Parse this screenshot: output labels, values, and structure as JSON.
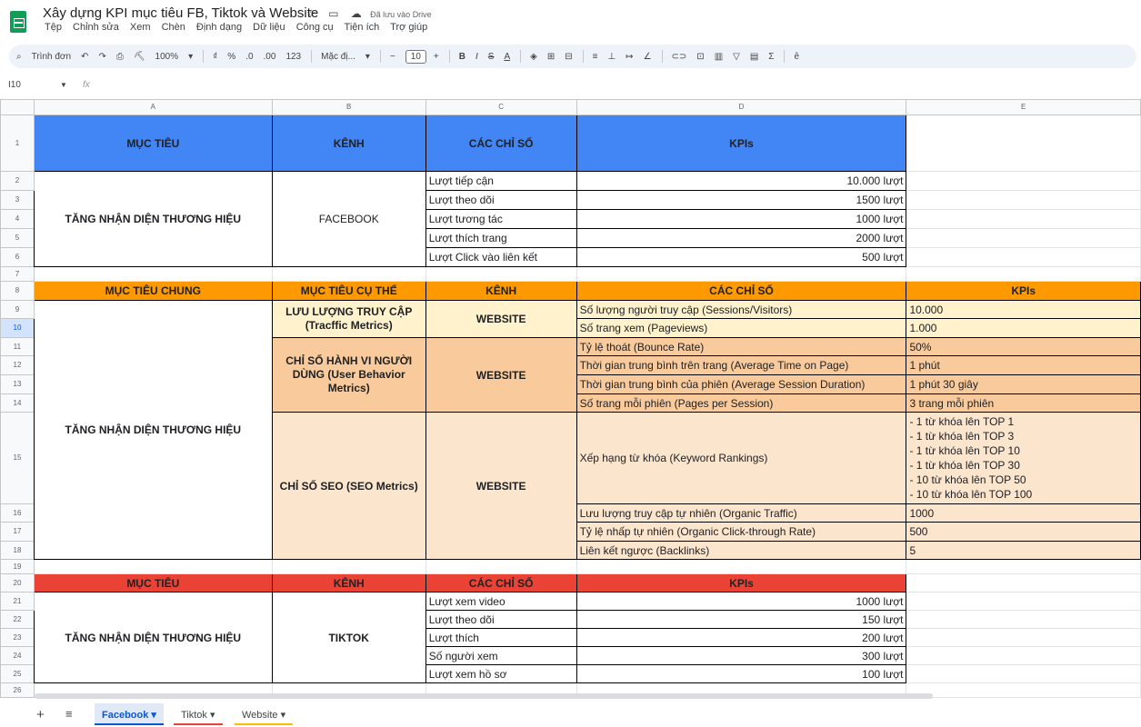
{
  "app": {
    "title": "Xây dựng KPI mục tiêu FB, Tiktok và Website",
    "save_status": "Đã lưu vào Drive",
    "icons": [
      "star-icon",
      "folder-move-icon",
      "cloud-saved-icon"
    ]
  },
  "menu": [
    "Tệp",
    "Chỉnh sửa",
    "Xem",
    "Chèn",
    "Định dạng",
    "Dữ liệu",
    "Công cụ",
    "Tiện ích",
    "Trợ giúp"
  ],
  "toolbar": {
    "search": "Trình đơn",
    "undo": "↶",
    "redo": "↷",
    "print": "⎙",
    "paint_format": "⛏",
    "zoom": "100%",
    "currency": "₫",
    "percent": "%",
    "dec_decrease": ".0",
    "dec_increase": ".00",
    "format_123": "123",
    "font": "Mặc đị...",
    "minus": "−",
    "font_size": "10",
    "plus": "+",
    "bold": "B",
    "italic": "I",
    "strike": "S",
    "text_color": "A"
  },
  "formula_bar": {
    "cell_ref": "I10",
    "fx": "fx",
    "value": ""
  },
  "columns": [
    "A",
    "B",
    "C",
    "D",
    "E"
  ],
  "rows": [
    "1",
    "2",
    "3",
    "4",
    "5",
    "6",
    "7",
    "8",
    "9",
    "10",
    "11",
    "12",
    "13",
    "14",
    "15",
    "16",
    "17",
    "18",
    "19",
    "20",
    "21",
    "22",
    "23",
    "24",
    "25",
    "26"
  ],
  "sheet": {
    "fb": {
      "headers": [
        "MỤC TIÊU",
        "KÊNH",
        "CÁC CHỈ SỐ",
        "KPIs"
      ],
      "goal": "TĂNG NHẬN DIỆN THƯƠNG HIỆU",
      "channel": "FACEBOOK",
      "metrics": [
        {
          "name": "Lượt tiếp cận",
          "kpi": "10.000 lượt"
        },
        {
          "name": "Lượt theo dõi",
          "kpi": "1500 lượt"
        },
        {
          "name": "Lượt tương tác",
          "kpi": "1000 lượt"
        },
        {
          "name": "Lượt thích trang",
          "kpi": "2000 lượt"
        },
        {
          "name": "Lượt Click vào liên kết",
          "kpi": "500 lượt"
        }
      ]
    },
    "web": {
      "headers": [
        "MỤC TIÊU CHUNG",
        "MỤC TIÊU CỤ THỂ",
        "KÊNH",
        "CÁC CHỈ SỐ",
        "KPIs"
      ],
      "goal": "TĂNG NHẬN DIỆN THƯƠNG HIỆU",
      "channel": "WEBSITE",
      "traffic": "LƯU LƯỢNG TRUY CẬP (Tracffic Metrics)",
      "behavior": "CHỈ SỐ HÀNH VI NGƯỜI DÙNG (User Behavior Metrics)",
      "seo": "CHỈ SỐ SEO (SEO Metrics)",
      "metrics": [
        {
          "name": "Số lượng người truy cập (Sessions/Visitors)",
          "kpi": "10.000"
        },
        {
          "name": "Số trang xem  (Pageviews)",
          "kpi": "1.000"
        },
        {
          "name": "Tỷ lệ thoát (Bounce Rate)",
          "kpi": "50%"
        },
        {
          "name": "Thời gian trung bình trên trang (Average Time on Page)",
          "kpi": "1 phút"
        },
        {
          "name": "Thời gian trung bình của phiên (Average Session Duration)",
          "kpi": "1 phút 30 giây"
        },
        {
          "name": "Số trang mỗi phiên (Pages per Session)",
          "kpi": "3 trang mỗi phiên"
        },
        {
          "name": "Xếp hạng từ khóa (Keyword Rankings)",
          "kpi": "- 1 từ khóa lên TOP 1\n- 1 từ khóa lên TOP 3\n- 1 từ khóa lên TOP 10\n- 1 từ khóa lên TOP 30\n- 10 từ khóa lên TOP 50\n- 10 từ khóa lên TOP 100"
        },
        {
          "name": "Lưu lượng truy cập tự nhiên (Organic Traffic)",
          "kpi": "1000"
        },
        {
          "name": "Tỷ lệ nhấp tự nhiên (Organic Click-through Rate)",
          "kpi": "500"
        },
        {
          "name": "Liên kết ngược (Backlinks)",
          "kpi": "5"
        }
      ]
    },
    "tt": {
      "headers": [
        "MỤC TIÊU",
        "KÊNH",
        "CÁC CHỈ SỐ",
        "KPIs"
      ],
      "goal": "TĂNG NHẬN DIỆN THƯƠNG HIỆU",
      "channel": "TIKTOK",
      "metrics": [
        {
          "name": "Lượt xem video",
          "kpi": "1000 lượt"
        },
        {
          "name": "Lượt theo dõi",
          "kpi": "150 lượt"
        },
        {
          "name": "Lượt thích",
          "kpi": "200 lượt"
        },
        {
          "name": "Số người xem",
          "kpi": "300 lượt"
        },
        {
          "name": "Lượt xem hồ sơ",
          "kpi": "100 lượt"
        }
      ]
    }
  },
  "tabs": [
    {
      "label": "Facebook",
      "arrow": "▾",
      "color": "#0b57d0"
    },
    {
      "label": "Tiktok",
      "arrow": "▾",
      "color": "#ea4335"
    },
    {
      "label": "Website",
      "arrow": "▾",
      "color": "#fbbc04"
    }
  ],
  "colors": {
    "header_blue": "#4285f4",
    "header_orange": "#ff9900",
    "header_red": "#ea4335",
    "traffic_bg": "#fff2cc",
    "behavior_bg": "#f9cb9c",
    "seo_bg": "#fce5cd"
  }
}
